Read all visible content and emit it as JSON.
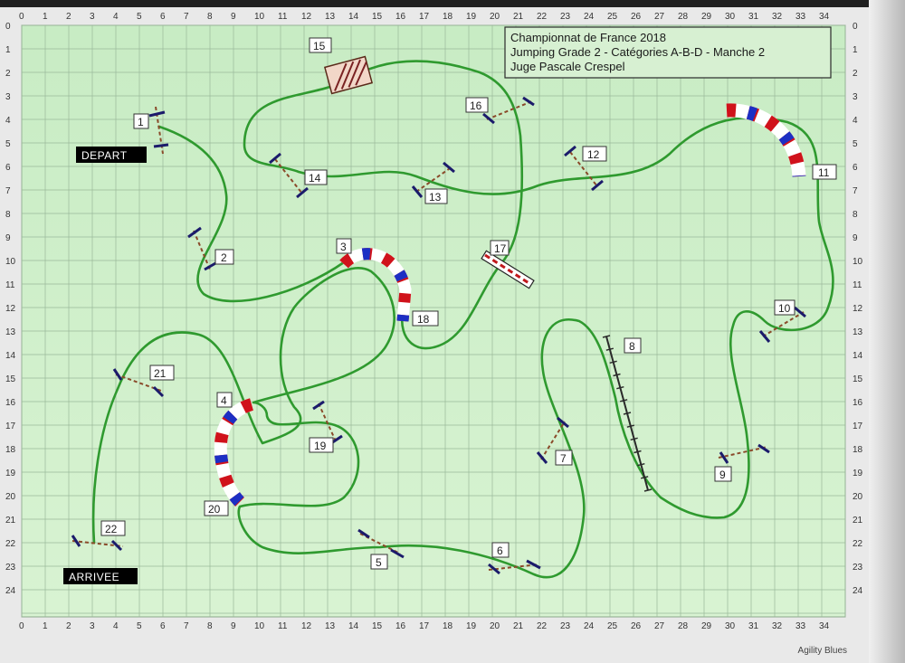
{
  "title_box": {
    "line1": "Championnat de France 2018",
    "line2": "Jumping Grade 2 - Catégories A-B-D - Manche 2",
    "line3": "Juge    Pascale Crespel"
  },
  "markers": {
    "start": "DEPART",
    "finish": "ARRIVEE"
  },
  "grid": {
    "columns": 35,
    "rows": 25
  },
  "obstacles": [
    {
      "n": "1",
      "type": "jump"
    },
    {
      "n": "2",
      "type": "jump"
    },
    {
      "n": "3",
      "type": "tunnel"
    },
    {
      "n": "4",
      "type": "tunnel"
    },
    {
      "n": "5",
      "type": "jump"
    },
    {
      "n": "6",
      "type": "jump"
    },
    {
      "n": "7",
      "type": "jump"
    },
    {
      "n": "8",
      "type": "weave-poles"
    },
    {
      "n": "9",
      "type": "jump"
    },
    {
      "n": "10",
      "type": "jump"
    },
    {
      "n": "11",
      "type": "tunnel"
    },
    {
      "n": "12",
      "type": "jump"
    },
    {
      "n": "13",
      "type": "jump"
    },
    {
      "n": "14",
      "type": "jump"
    },
    {
      "n": "15",
      "type": "tire"
    },
    {
      "n": "16",
      "type": "jump"
    },
    {
      "n": "17",
      "type": "long-jump"
    },
    {
      "n": "18",
      "type": "tunnel"
    },
    {
      "n": "19",
      "type": "jump"
    },
    {
      "n": "20",
      "type": "tunnel"
    },
    {
      "n": "21",
      "type": "jump"
    },
    {
      "n": "22",
      "type": "jump"
    }
  ],
  "credit": "Agility Blues",
  "colors": {
    "field": "#cdeec8",
    "grid": "#9ab89a",
    "path": "#2f9a2f",
    "tunnel_red": "#d0121b",
    "tunnel_blue": "#1c2fc4",
    "marker_bg": "#000000"
  }
}
